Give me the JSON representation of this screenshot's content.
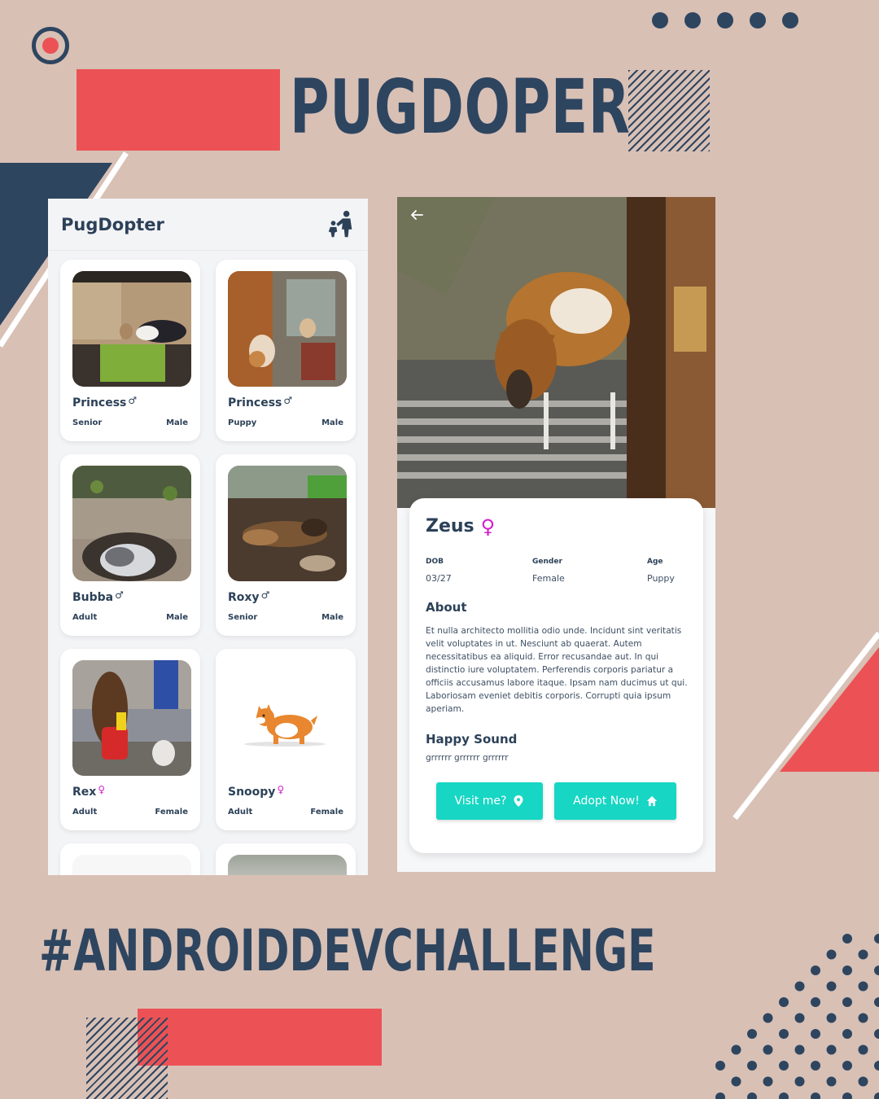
{
  "poster": {
    "title": "PUGDOPER",
    "hashtag": "#ANDROIDDEVCHALLENGE",
    "colors": {
      "background": "#d8c0b5",
      "navy": "#2e4560",
      "red": "#ec5255",
      "accent_teal": "#17d6c3",
      "female_pink": "#d11fc8"
    }
  },
  "list_screen": {
    "app_title": "PugDopter",
    "header_icon": "family-icon",
    "pets": [
      {
        "name": "Princess",
        "gender_symbol": "♂",
        "age": "Senior",
        "gender": "Male",
        "photo": "dog-with-person-photo"
      },
      {
        "name": "Princess",
        "gender_symbol": "♂",
        "age": "Puppy",
        "gender": "Male",
        "photo": "puppy-at-door-photo"
      },
      {
        "name": "Bubba",
        "gender_symbol": "♂",
        "age": "Adult",
        "gender": "Male",
        "photo": "husky-in-hole-photo"
      },
      {
        "name": "Roxy",
        "gender_symbol": "♂",
        "age": "Senior",
        "gender": "Male",
        "photo": "shepherd-in-garden-photo"
      },
      {
        "name": "Rex",
        "gender_symbol": "♀",
        "age": "Adult",
        "gender": "Female",
        "photo": "dogs-on-street-photo"
      },
      {
        "name": "Snoopy",
        "gender_symbol": "♀",
        "age": "Adult",
        "gender": "Female",
        "photo": "corgi-illustration"
      }
    ]
  },
  "detail_screen": {
    "back_icon": "back-arrow-icon",
    "name": "Zeus",
    "gender_symbol": "♀",
    "info": [
      {
        "label": "DOB",
        "value": "03/27"
      },
      {
        "label": "Gender",
        "value": "Female"
      },
      {
        "label": "Age",
        "value": "Puppy"
      }
    ],
    "about_title": "About",
    "about_text": "Et nulla architecto mollitia odio unde. Incidunt sint veritatis velit voluptates in ut. Nesciunt ab quaerat. Autem necessitatibus ea aliquid. Error recusandae aut. In qui distinctio iure voluptatem. Perferendis corporis pariatur a officiis accusamus labore itaque. Ipsam nam ducimus ut qui. Laboriosam eveniet debitis corporis. Corrupti quia ipsum aperiam.",
    "sound_title": "Happy Sound",
    "sound_text": "grrrrrr grrrrrr grrrrrr",
    "buttons": {
      "visit": "Visit me?",
      "adopt": "Adopt Now!"
    }
  }
}
